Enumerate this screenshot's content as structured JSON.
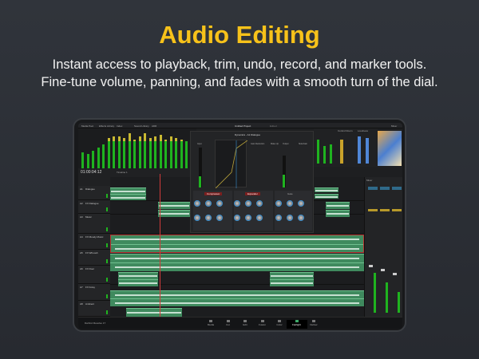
{
  "header": {
    "title": "Audio Editing",
    "subtitle_line1": "Instant access to playback, trim, undo, record, and marker tools.",
    "subtitle_line2": "Fine-tune volume, panning, and fades with a smooth turn of the dial."
  },
  "app": {
    "toolbar": [
      "Media Pool",
      "Effects Library",
      "Index",
      "Sound Library",
      "ADR"
    ],
    "project_title": "Untitled Project",
    "edited": "Edited",
    "mixer_label": "Mixer",
    "timecode": "01:00:04:12",
    "timeline_name": "Timeline 1",
    "dynamics_title": "Dynamics - A1 Dialogue",
    "dyn_sections": [
      "Input",
      "Gain Reduction",
      "Make Up",
      "Output",
      "Sidechain"
    ],
    "compressor_label": "Compressor",
    "gate_label": "Gate",
    "expander_label": "Expander",
    "loudness_label": "Loudness",
    "control_room_label": "Control Room",
    "tracks": [
      "Dialogue",
      "FX Dialogue",
      "Music",
      "FX Moody Music",
      "FX Whoosh",
      "FX Door",
      "FX Foley",
      "Ambient"
    ],
    "track_ids": [
      "A1",
      "A2",
      "A3",
      "A4",
      "A5",
      "A6",
      "A7",
      "A8"
    ],
    "mixer_title": "Mixer",
    "pages": [
      "Media",
      "Cut",
      "Edit",
      "Fusion",
      "Color",
      "Fairlight",
      "Deliver"
    ],
    "active_page": "Fairlight",
    "brand": "DaVinci Resolve 17"
  },
  "colors": {
    "accent": "#f7c21a",
    "clip": "#3f8a5e",
    "playhead": "#d03a3a",
    "meter": "#1fb31f"
  }
}
